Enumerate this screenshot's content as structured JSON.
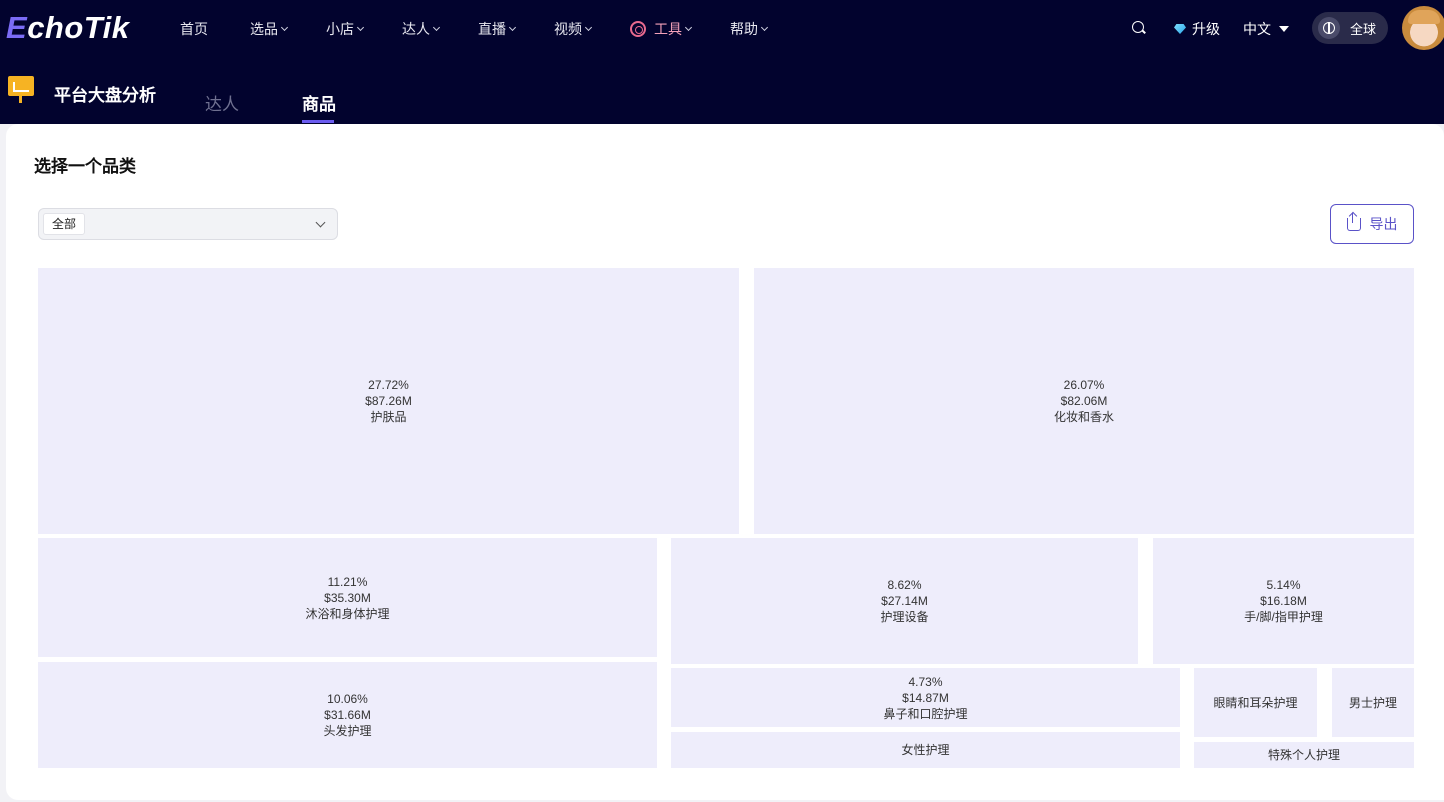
{
  "header": {
    "logo": {
      "first_letter": "E",
      "rest": "choTik"
    },
    "nav": [
      {
        "label": "首页",
        "has_dropdown": false
      },
      {
        "label": "选品",
        "has_dropdown": true
      },
      {
        "label": "小店",
        "has_dropdown": true
      },
      {
        "label": "达人",
        "has_dropdown": true
      },
      {
        "label": "直播",
        "has_dropdown": true
      },
      {
        "label": "视频",
        "has_dropdown": true
      },
      {
        "label": "工具",
        "has_dropdown": true
      },
      {
        "label": "帮助",
        "has_dropdown": true
      }
    ],
    "upgrade_label": "升级",
    "language_label": "中文",
    "region_label": "全球"
  },
  "subheader": {
    "title": "平台大盘分析",
    "tabs": [
      {
        "label": "达人",
        "active": false
      },
      {
        "label": "商品",
        "active": true
      }
    ]
  },
  "main": {
    "title": "选择一个品类",
    "category_select": {
      "selected": "全部"
    },
    "export_label": "导出"
  },
  "treemap": {
    "tiles": [
      {
        "percent": "27.72%",
        "value": "$87.26M",
        "name": "护肤品"
      },
      {
        "percent": "26.07%",
        "value": "$82.06M",
        "name": "化妆和香水"
      },
      {
        "percent": "11.21%",
        "value": "$35.30M",
        "name": "沐浴和身体护理"
      },
      {
        "percent": "8.62%",
        "value": "$27.14M",
        "name": "护理设备"
      },
      {
        "percent": "5.14%",
        "value": "$16.18M",
        "name": "手/脚/指甲护理"
      },
      {
        "percent": "10.06%",
        "value": "$31.66M",
        "name": "头发护理"
      },
      {
        "percent": "4.73%",
        "value": "$14.87M",
        "name": "鼻子和口腔护理"
      },
      {
        "percent": "",
        "value": "",
        "name": "女性护理"
      },
      {
        "percent": "",
        "value": "",
        "name": "眼睛和耳朵护理"
      },
      {
        "percent": "",
        "value": "",
        "name": "男士护理"
      },
      {
        "percent": "",
        "value": "",
        "name": "特殊个人护理"
      }
    ]
  },
  "colors": {
    "header_bg": "#02032e",
    "accent": "#5a52c8",
    "tile_bg": "#eeedfb",
    "tools_color": "#f2a0b8"
  }
}
